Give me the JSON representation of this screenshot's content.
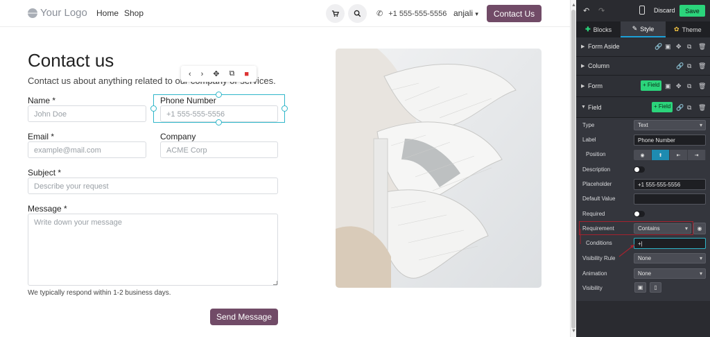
{
  "navbar": {
    "logo_text": "Your Logo",
    "links": [
      "Home",
      "Shop"
    ],
    "phone": "+1 555-555-5556",
    "user": "anjali",
    "cta": "Contact Us"
  },
  "page": {
    "title": "Contact us",
    "subtitle": "Contact us about anything related to our company or services.",
    "note": "We typically respond within 1-2 business days.",
    "submit": "Send Message"
  },
  "form": {
    "fields": [
      {
        "label": "Name *",
        "placeholder": "John Doe"
      },
      {
        "label": "Phone Number",
        "placeholder": "+1 555-555-5556"
      },
      {
        "label": "Email *",
        "placeholder": "example@mail.com"
      },
      {
        "label": "Company",
        "placeholder": "ACME Corp"
      },
      {
        "label": "Subject *",
        "placeholder": "Describe your request"
      },
      {
        "label": "Message *",
        "placeholder": "Write down your message"
      }
    ]
  },
  "sidebar": {
    "discard": "Discard",
    "save": "Save",
    "tabs": [
      "Blocks",
      "Style",
      "Theme"
    ],
    "active_tab": "Style",
    "sections": [
      "Form Aside",
      "Column",
      "Form",
      "Field"
    ],
    "add_field": "+ Field",
    "props": {
      "type_label": "Type",
      "type_value": "Text",
      "label_label": "Label",
      "label_value": "Phone Number",
      "position_label": "Position",
      "description_label": "Description",
      "placeholder_label": "Placeholder",
      "placeholder_value": "+1 555-555-5556",
      "default_label": "Default Value",
      "default_value": "",
      "required_label": "Required",
      "requirement_label": "Requirement",
      "requirement_value": "Contains",
      "conditions_label": "Conditions",
      "conditions_value": "+|",
      "visibility_rule_label": "Visibility Rule",
      "visibility_rule_value": "None",
      "animation_label": "Animation",
      "animation_value": "None",
      "visibility_label": "Visibility"
    }
  },
  "colors": {
    "brand": "#714b67",
    "save_green": "#2bd47b",
    "selection": "#2eb6c9",
    "sidebar_bg": "#2a2b30",
    "annotation_red": "#a5222e"
  }
}
